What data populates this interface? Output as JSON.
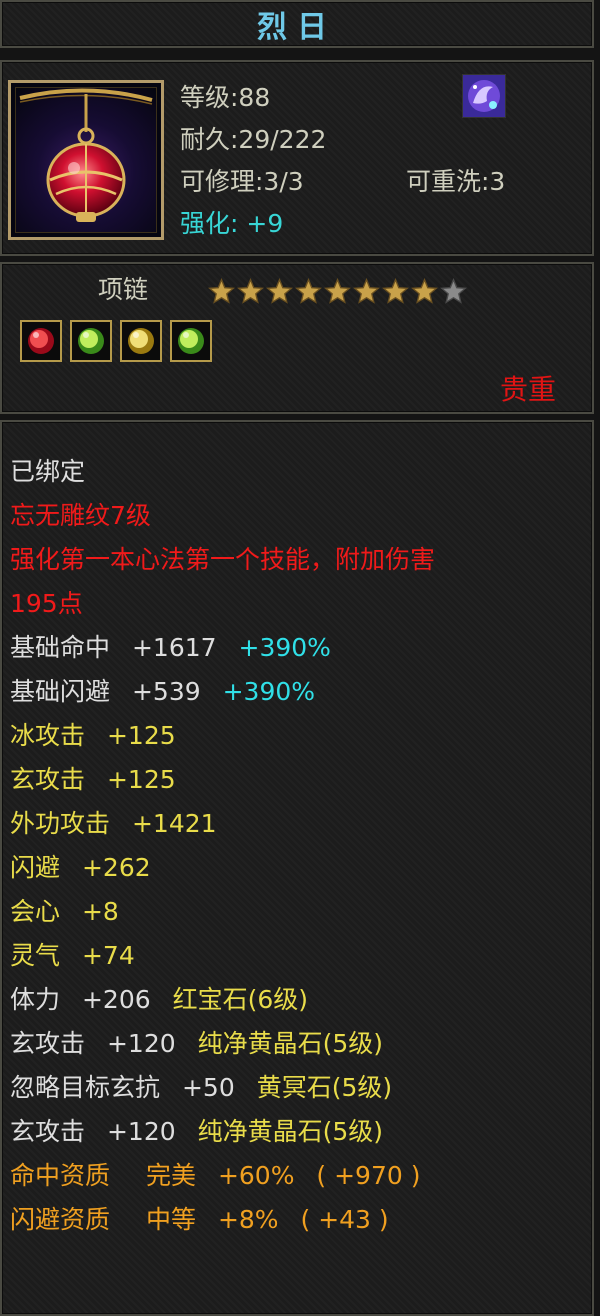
{
  "item": {
    "name": "烈日",
    "level": "等级:88",
    "durability": "耐久:29/222",
    "repairable": "可修理:3/3",
    "rewashable": "可重洗:3",
    "enhance_label": "强化:",
    "enhance_value": "+9",
    "type": "项链",
    "stars_filled": 8,
    "stars_total": 9,
    "rarity": "贵重"
  },
  "gem_icons": [
    "red-gem-icon",
    "green-gem-icon",
    "yellow-gem-icon",
    "green-gem-icon"
  ],
  "attributes": {
    "bound": "已绑定",
    "engrave": "忘无雕纹7级",
    "skill_line1": "强化第一本心法第一个技能，附加伤害",
    "skill_line2": "195点",
    "hit_base": {
      "label": "基础命中",
      "value": "+1617",
      "pct": "+390%"
    },
    "dodge_base": {
      "label": "基础闪避",
      "value": "+539",
      "pct": "+390%"
    },
    "ice_attack": {
      "label": "冰攻击",
      "value": "+125"
    },
    "xuan_attack": {
      "label": "玄攻击",
      "value": "+125"
    },
    "outer_attack": {
      "label": "外功攻击",
      "value": "+1421"
    },
    "dodge": {
      "label": "闪避",
      "value": "+262"
    },
    "crit": {
      "label": "会心",
      "value": "+8"
    },
    "spirit": {
      "label": "灵气",
      "value": "+74"
    },
    "gem1": {
      "label": "体力",
      "value": "+206",
      "gem": "红宝石(6级)"
    },
    "gem2": {
      "label": "玄攻击",
      "value": "+120",
      "gem": "纯净黄晶石(5级)"
    },
    "gem3": {
      "label": "忽略目标玄抗",
      "value": "+50",
      "gem": "黄冥石(5级)"
    },
    "gem4": {
      "label": "玄攻击",
      "value": "+120",
      "gem": "纯净黄晶石(5级)"
    },
    "quality1": {
      "label": "命中资质",
      "grade": "完美",
      "value": "+60%",
      "extra": "( +970 )"
    },
    "quality2": {
      "label": "闪避资质",
      "grade": "中等",
      "value": "+8%",
      "extra": "( +43 )"
    }
  },
  "colors": {
    "title": "#6fc9e8",
    "cyan": "#30e0e8",
    "red": "#f01a1a",
    "yellow": "#e9dc4a",
    "orange": "#f0a020",
    "gold_border": "#b39b6a"
  }
}
